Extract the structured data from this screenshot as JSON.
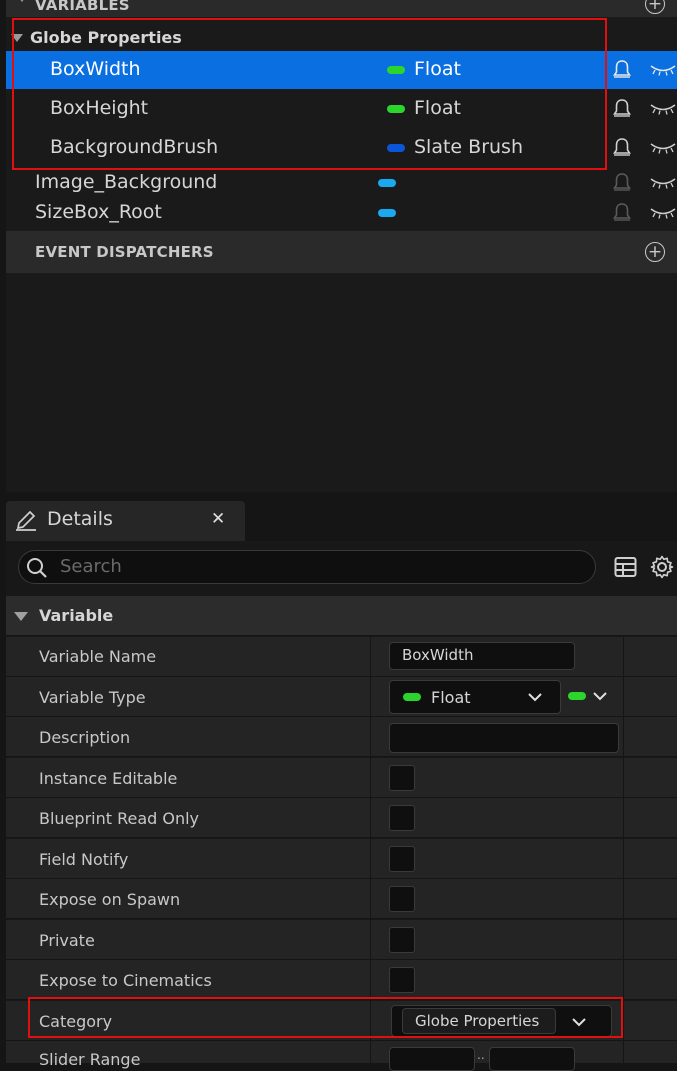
{
  "my_blueprint": {
    "variables_header": "VARIABLES",
    "category_name": "Globe Properties",
    "category_vars": [
      {
        "name": "BoxWidth",
        "type": "Float",
        "type_color": "#2bd52b",
        "selected": true
      },
      {
        "name": "BoxHeight",
        "type": "Float",
        "type_color": "#2bd52b",
        "selected": false
      },
      {
        "name": "BackgroundBrush",
        "type": "Slate Brush",
        "type_color": "#0b56d8",
        "selected": false
      }
    ],
    "other_vars": [
      {
        "name": "Image_Background",
        "type_color": "#1aa8f0"
      },
      {
        "name": "SizeBox_Root",
        "type_color": "#1aa8f0"
      }
    ],
    "event_dispatchers_header": "EVENT DISPATCHERS"
  },
  "details": {
    "tab_title": "Details",
    "search_placeholder": "Search",
    "section_title": "Variable",
    "rows": {
      "variable_name_label": "Variable Name",
      "variable_name_value": "BoxWidth",
      "variable_type_label": "Variable Type",
      "variable_type_value": "Float",
      "description_label": "Description",
      "instance_editable_label": "Instance Editable",
      "blueprint_read_only_label": "Blueprint Read Only",
      "field_notify_label": "Field Notify",
      "expose_on_spawn_label": "Expose on Spawn",
      "private_label": "Private",
      "expose_to_cinematics_label": "Expose to Cinematics",
      "category_label": "Category",
      "category_value": "Globe Properties",
      "slider_range_label": "Slider Range"
    }
  },
  "colors": {
    "selection": "#0a6fe0",
    "float_pin": "#2bd52b",
    "slate_brush_pin": "#0b56d8",
    "object_pin": "#1aa8f0",
    "highlight_box": "#e01010"
  }
}
